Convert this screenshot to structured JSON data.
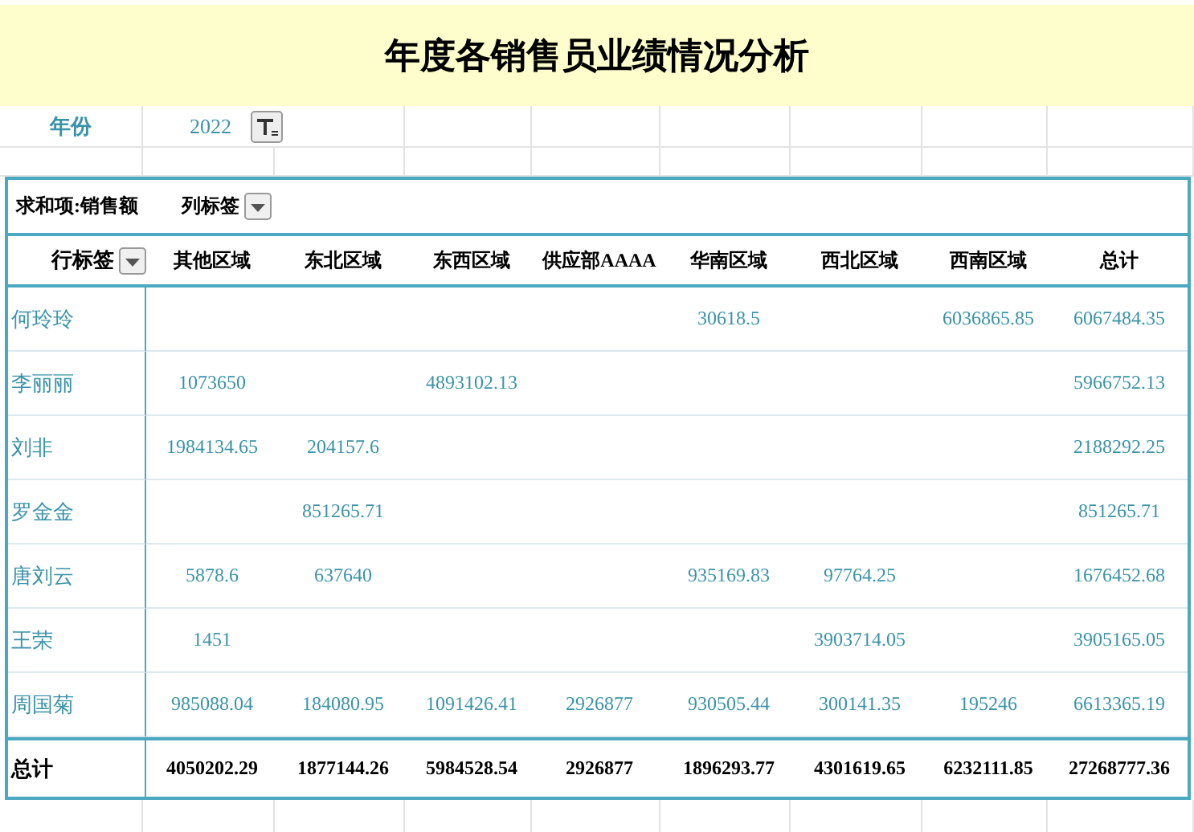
{
  "title": "年度各销售员业绩情况分析",
  "filter": {
    "label": "年份",
    "value": "2022"
  },
  "pivot": {
    "value_label": "求和项:销售额",
    "column_label": "列标签",
    "row_label": "行标签",
    "columns": [
      "其他区域",
      "东北区域",
      "东西区域",
      "供应部AAAA",
      "华南区域",
      "西北区域",
      "西南区域",
      "总计"
    ],
    "rows": [
      {
        "name": "何玲玲",
        "cells": [
          null,
          null,
          null,
          null,
          "30618.5",
          null,
          "6036865.85",
          "6067484.35"
        ]
      },
      {
        "name": "李丽丽",
        "cells": [
          "1073650",
          null,
          "4893102.13",
          null,
          null,
          null,
          null,
          "5966752.13"
        ]
      },
      {
        "name": "刘非",
        "cells": [
          "1984134.65",
          "204157.6",
          null,
          null,
          null,
          null,
          null,
          "2188292.25"
        ]
      },
      {
        "name": "罗金金",
        "cells": [
          null,
          "851265.71",
          null,
          null,
          null,
          null,
          null,
          "851265.71"
        ]
      },
      {
        "name": "唐刘云",
        "cells": [
          "5878.6",
          "637640",
          null,
          null,
          "935169.83",
          "97764.25",
          null,
          "1676452.68"
        ]
      },
      {
        "name": "王荣",
        "cells": [
          "1451",
          null,
          null,
          null,
          null,
          "3903714.05",
          null,
          "3905165.05"
        ]
      },
      {
        "name": "周国菊",
        "cells": [
          "985088.04",
          "184080.95",
          "1091426.41",
          "2926877",
          "930505.44",
          "300141.35",
          "195246",
          "6613365.19"
        ]
      }
    ],
    "total": {
      "label": "总计",
      "cells": [
        "4050202.29",
        "1877144.26",
        "5984528.54",
        "2926877",
        "1896293.77",
        "4301619.65",
        "6232111.85",
        "27268777.36"
      ]
    }
  }
}
